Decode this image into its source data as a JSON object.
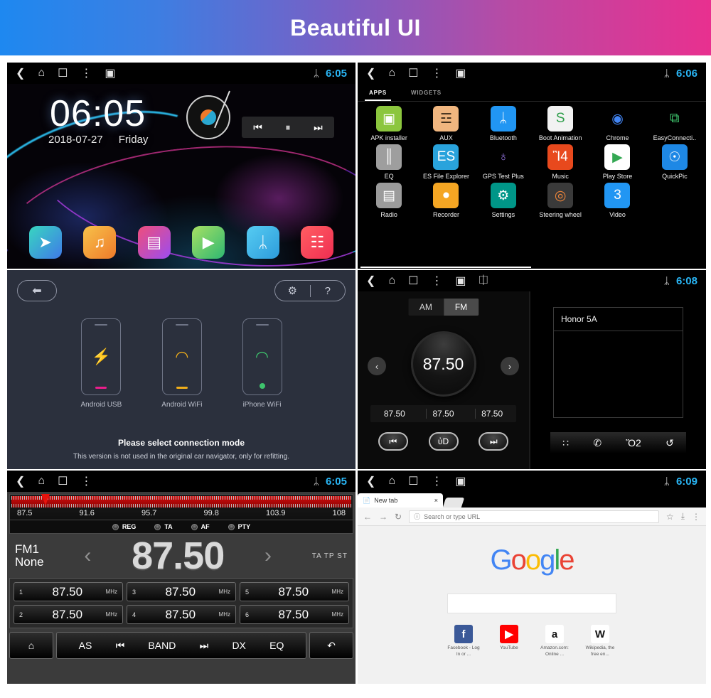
{
  "banner": {
    "title": "Beautiful UI"
  },
  "statusbar": {
    "time_home": "6:05",
    "time_apps": "6:06",
    "time_radio_bt": "6:08",
    "time_tuner": "6:05",
    "time_browser": "6:09",
    "bluetooth_glyph": "ᛦ"
  },
  "home": {
    "clock": "06:05",
    "date": "2018-07-27",
    "weekday": "Friday",
    "media": {
      "prev": "⏮",
      "pause": "⏸",
      "next": "⏭"
    },
    "dock": [
      {
        "name": "navigation",
        "glyph": "➤",
        "color1": "#38d6c0",
        "color2": "#3f7ae8"
      },
      {
        "name": "music",
        "glyph": "♫",
        "color1": "#f7c24a",
        "color2": "#ef7a2a"
      },
      {
        "name": "radio",
        "glyph": "▤",
        "color1": "#ef4e7b",
        "color2": "#9b4df0"
      },
      {
        "name": "video",
        "glyph": "▶",
        "color1": "#a8e063",
        "color2": "#2eb872"
      },
      {
        "name": "bluetooth",
        "glyph": "ᛦ",
        "color1": "#56ccf2",
        "color2": "#2d9cdb"
      },
      {
        "name": "all-apps",
        "glyph": "☷",
        "color1": "#ff5e62",
        "color2": "#f02e52"
      }
    ]
  },
  "drawer": {
    "tabs": [
      {
        "label": "APPS",
        "active": true
      },
      {
        "label": "WIDGETS",
        "active": false
      }
    ],
    "apps": [
      {
        "label": "APK installer",
        "glyph": "▣",
        "bg": "#8cc63e",
        "fg": "#ffffff"
      },
      {
        "label": "AUX",
        "glyph": "☲",
        "bg": "#f0b67f",
        "fg": "#3a2a18"
      },
      {
        "label": "Bluetooth",
        "glyph": "ᛦ",
        "bg": "#2196f3",
        "fg": "#ffffff"
      },
      {
        "label": "Boot Animation",
        "glyph": "S",
        "bg": "#f2f2f2",
        "fg": "#2e9e4a"
      },
      {
        "label": "Chrome",
        "glyph": "◉",
        "bg": "#000000",
        "fg": "#4285f4"
      },
      {
        "label": "EasyConnecti..",
        "glyph": "⧉",
        "bg": "#000000",
        "fg": "#3ec46d"
      },
      {
        "label": "EQ",
        "glyph": "║",
        "bg": "#9e9e9e",
        "fg": "#ffffff"
      },
      {
        "label": "ES File Explorer",
        "glyph": "ES",
        "bg": "#29a3dc",
        "fg": "#ffffff"
      },
      {
        "label": "GPS Test Plus",
        "glyph": "♁",
        "bg": "#000000",
        "fg": "#8e6fd8"
      },
      {
        "label": "Music",
        "glyph": "Ἲ4",
        "bg": "#e8491d",
        "fg": "#ffffff"
      },
      {
        "label": "Play Store",
        "glyph": "▶",
        "bg": "#ffffff",
        "fg": "#34a853"
      },
      {
        "label": "QuickPic",
        "glyph": "☉",
        "bg": "#1e88e5",
        "fg": "#ffffff"
      },
      {
        "label": "Radio",
        "glyph": "▤",
        "bg": "#9b9b9b",
        "fg": "#ffffff"
      },
      {
        "label": "Recorder",
        "glyph": "●",
        "bg": "#f5a623",
        "fg": "#ffffff"
      },
      {
        "label": "Settings",
        "glyph": "⚙",
        "bg": "#009688",
        "fg": "#ffffff"
      },
      {
        "label": "Steering wheel",
        "glyph": "◎",
        "bg": "#3a3a3a",
        "fg": "#e8833a"
      },
      {
        "label": "Video",
        "glyph": "3",
        "bg": "#2196f3",
        "fg": "#ffffff"
      }
    ]
  },
  "easyconnection": {
    "back_glyph": "⬅",
    "tools": [
      {
        "name": "settings",
        "glyph": "⚙"
      },
      {
        "name": "help",
        "glyph": "?"
      }
    ],
    "modes": [
      {
        "label": "Android USB",
        "glyph": "⚡",
        "color": "#e91e8c"
      },
      {
        "label": "Android WiFi",
        "glyph": "◠",
        "color": "#f0ae1a"
      },
      {
        "label": "iPhone WiFi",
        "glyph": "◠",
        "color": "#3ec46d"
      }
    ],
    "message": "Please select connection mode",
    "submessage": "This version is not used in the original car navigator, only for refitting."
  },
  "radio_bt": {
    "bands": [
      {
        "label": "AM",
        "active": false
      },
      {
        "label": "FM",
        "active": true
      }
    ],
    "frequency": "87.50",
    "prev_glyph": "‹",
    "next_glyph": "›",
    "presets": [
      "87.50",
      "87.50",
      "87.50"
    ],
    "transport": [
      {
        "name": "previous",
        "glyph": "⏮"
      },
      {
        "name": "scan",
        "glyph": "ὐD"
      },
      {
        "name": "next",
        "glyph": "⏭"
      }
    ],
    "bt_device": "Honor 5A",
    "bt_toolbar": [
      {
        "name": "dialpad",
        "glyph": "∷"
      },
      {
        "name": "call",
        "glyph": "✆"
      },
      {
        "name": "contacts",
        "glyph": "Ὅ2"
      },
      {
        "name": "call-history",
        "glyph": "↺"
      }
    ]
  },
  "tuner": {
    "scale_ticks": [
      "87.5",
      "91.6",
      "95.7",
      "99.8",
      "103.9",
      "108"
    ],
    "pointer_percent": 10,
    "rds": [
      "REG",
      "TA",
      "AF",
      "PTY"
    ],
    "band": "FM1",
    "station_name": "None",
    "frequency": "87.50",
    "prev_glyph": "‹",
    "next_glyph": "›",
    "indicators": "TA TP ST",
    "presets": [
      {
        "num": "1",
        "freq": "87.50",
        "unit": "MHz"
      },
      {
        "num": "3",
        "freq": "87.50",
        "unit": "MHz"
      },
      {
        "num": "5",
        "freq": "87.50",
        "unit": "MHz"
      },
      {
        "num": "2",
        "freq": "87.50",
        "unit": "MHz"
      },
      {
        "num": "4",
        "freq": "87.50",
        "unit": "MHz"
      },
      {
        "num": "6",
        "freq": "87.50",
        "unit": "MHz"
      }
    ],
    "home_glyph": "⌂",
    "back_glyph": "↶",
    "controls": [
      "AS",
      "⏮",
      "BAND",
      "⏭",
      "DX",
      "EQ"
    ]
  },
  "browser": {
    "tab_title": "New tab",
    "tab_close": "×",
    "nav": {
      "back": "←",
      "forward": "→",
      "reload": "↻",
      "info": "ⓘ"
    },
    "omnibox_placeholder": "Search or type URL",
    "actions": [
      {
        "name": "bookmark",
        "glyph": "☆"
      },
      {
        "name": "download",
        "glyph": "⤓"
      },
      {
        "name": "menu",
        "glyph": "⋮"
      }
    ],
    "logo": [
      "G",
      "o",
      "o",
      "g",
      "l",
      "e"
    ],
    "shortcuts": [
      {
        "label": "Facebook - Log In or ...",
        "glyph": "f",
        "bg": "#3b5998",
        "fg": "#ffffff"
      },
      {
        "label": "YouTube",
        "glyph": "▶",
        "bg": "#ff0000",
        "fg": "#ffffff"
      },
      {
        "label": "Amazon.com: Online ...",
        "glyph": "a",
        "bg": "#ffffff",
        "fg": "#111111"
      },
      {
        "label": "Wikipedia, the free en...",
        "glyph": "W",
        "bg": "#ffffff",
        "fg": "#111111"
      }
    ]
  }
}
